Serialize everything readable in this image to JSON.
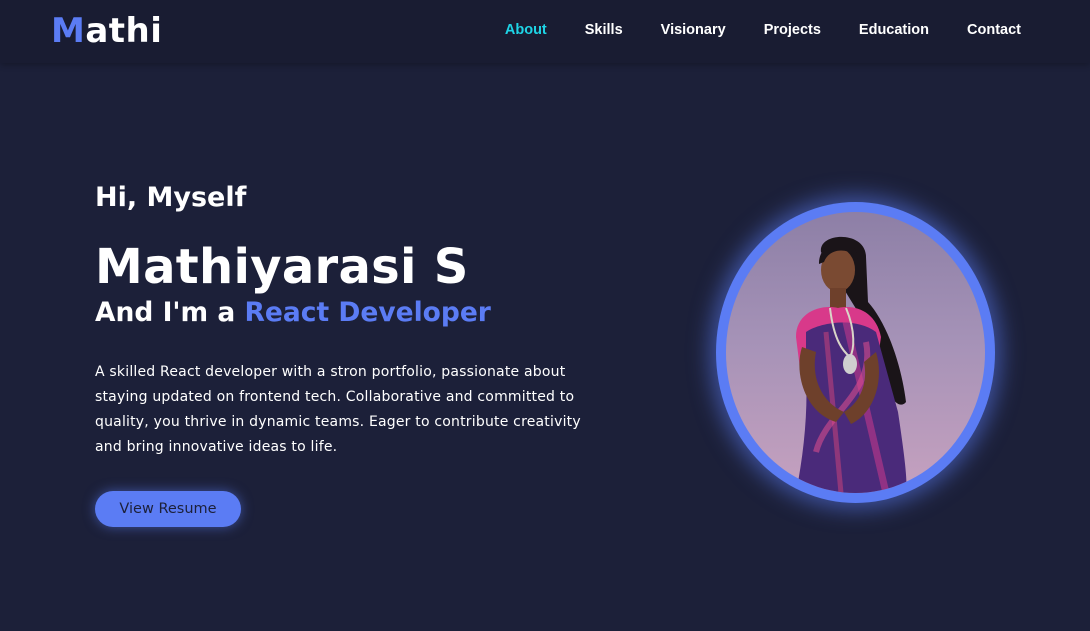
{
  "nav": {
    "logo": {
      "first_letter": "M",
      "rest": "athi"
    },
    "links": [
      {
        "label": "About",
        "active": true
      },
      {
        "label": "Skills",
        "active": false
      },
      {
        "label": "Visionary",
        "active": false
      },
      {
        "label": "Projects",
        "active": false
      },
      {
        "label": "Education",
        "active": false
      },
      {
        "label": "Contact",
        "active": false
      }
    ]
  },
  "hero": {
    "greeting": "Hi, Myself",
    "name": "Mathiyarasi S",
    "role_prefix": "And I'm a ",
    "role_highlight": "React Developer",
    "description": "A skilled React developer with a stron portfolio, passionate about staying updated on frontend tech. Collaborative and committed to quality, you thrive in dynamic teams. Eager to contribute creativity and bring innovative ideas to life.",
    "resume_button": "View Resume"
  },
  "colors": {
    "background": "#1c2039",
    "navbar": "#191c32",
    "accent": "#5b7cf4",
    "active_link": "#1ed4e6"
  },
  "icons": {
    "profile_photo": "profile-photo"
  }
}
